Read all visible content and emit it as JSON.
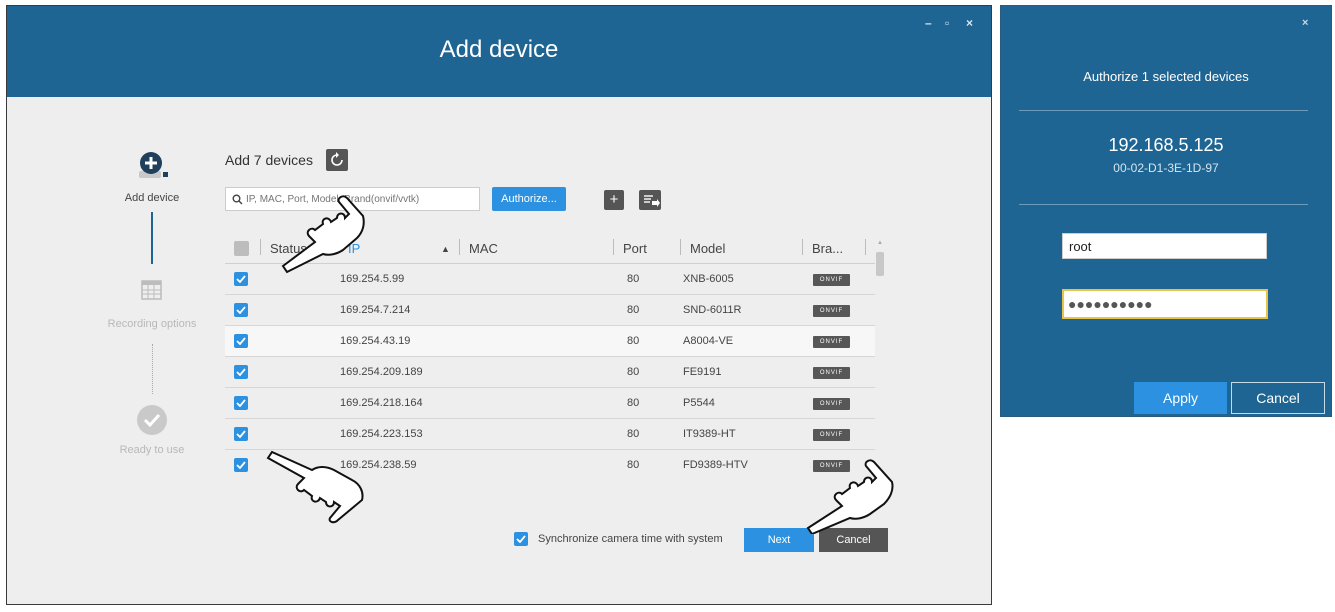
{
  "window": {
    "title": "Add device",
    "controls": {
      "minimize": "–",
      "maximize": "▫",
      "close": "×"
    }
  },
  "steps": [
    {
      "label": "Add device",
      "icon": "add-device-icon",
      "state": "active"
    },
    {
      "label": "Recording options",
      "icon": "calendar-icon",
      "state": "inactive"
    },
    {
      "label": "Ready to use",
      "icon": "check-circle-icon",
      "state": "inactive"
    }
  ],
  "device_list": {
    "header_text": "Add 7 devices",
    "search_placeholder": "IP, MAC, Port, Model, Brand(onvif/vvtk)",
    "authorize_label": "Authorize...",
    "add_label": "+",
    "columns": {
      "status": "Status",
      "ip": "IP",
      "mac": "MAC",
      "port": "Port",
      "model": "Model",
      "brand": "Bra..."
    },
    "rows": [
      {
        "ip": "169.254.5.99",
        "mac": "",
        "port": "80",
        "model": "XNB-6005",
        "brand": "ONVIF"
      },
      {
        "ip": "169.254.7.214",
        "mac": "",
        "port": "80",
        "model": "SND-6011R",
        "brand": "ONVIF"
      },
      {
        "ip": "169.254.43.19",
        "mac": "",
        "port": "80",
        "model": "A8004-VE",
        "brand": "ONVIF"
      },
      {
        "ip": "169.254.209.189",
        "mac": "",
        "port": "80",
        "model": "FE9191",
        "brand": "ONVIF"
      },
      {
        "ip": "169.254.218.164",
        "mac": "",
        "port": "80",
        "model": "P5544",
        "brand": "ONVIF"
      },
      {
        "ip": "169.254.223.153",
        "mac": "",
        "port": "80",
        "model": "IT9389-HT",
        "brand": "ONVIF"
      },
      {
        "ip": "169.254.238.59",
        "mac": "",
        "port": "80",
        "model": "FD9389-HTV",
        "brand": "ONVIF"
      }
    ]
  },
  "footer": {
    "sync_label": "Synchronize camera time with system",
    "next_label": "Next",
    "cancel_label": "Cancel"
  },
  "auth_dialog": {
    "close": "×",
    "title": "Authorize 1 selected devices",
    "device_ip": "192.168.5.125",
    "device_mac": "00-02-D1-3E-1D-97",
    "username": "root",
    "password_masked": "●●●●●●●●●●",
    "apply_label": "Apply",
    "cancel_label": "Cancel"
  },
  "colors": {
    "header_blue": "#1f6593",
    "accent_blue": "#2b91e0",
    "focus_yellow": "#e8c34a"
  }
}
